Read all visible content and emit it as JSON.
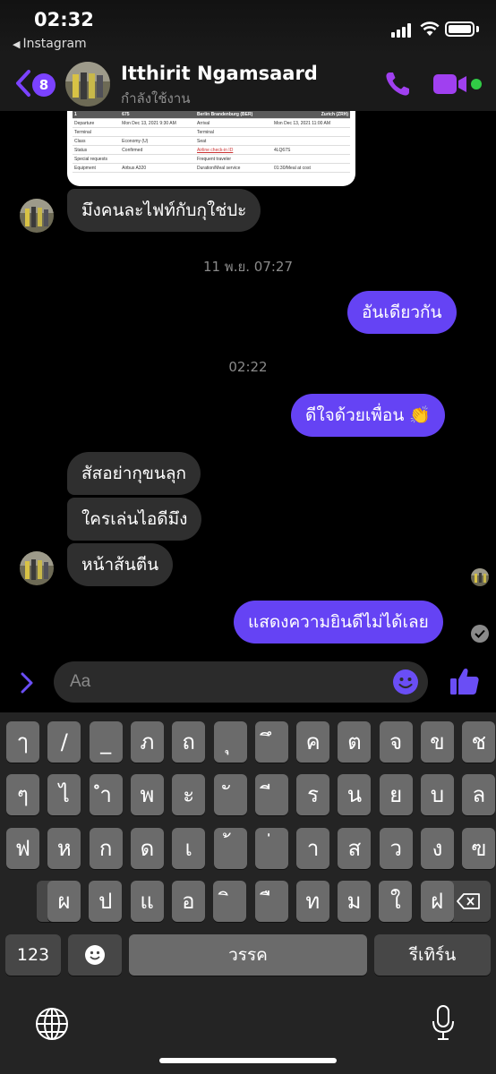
{
  "status_bar": {
    "time": "02:32",
    "back_app": "Instagram"
  },
  "header": {
    "unread_count": "8",
    "contact_name": "Itthirit Ngamsaard",
    "contact_status": "กำลังใช้งาน",
    "accent_color": "#7b42ff",
    "online_color": "#31cc46"
  },
  "attachment": {
    "header": [
      "1",
      "675",
      "Berlin Brandenburg (BER)",
      "Zurich (ZRH)"
    ],
    "rows": [
      [
        "Departure",
        "Mon Dec 13, 2021 9:30 AM",
        "Arrival",
        "Mon Dec 13, 2021 11:00 AM"
      ],
      [
        "Terminal",
        "",
        "Terminal",
        ""
      ],
      [
        "Class",
        "Economy (U)",
        "Seat",
        ""
      ],
      [
        "Status",
        "Confirmed",
        "Airline check-in ID",
        "4LQ67S"
      ],
      [
        "Special requests",
        "",
        "Frequent traveler",
        ""
      ],
      [
        "Equipment",
        "Airbus A320",
        "Duration/Meal service",
        "01:30/Meal at cost"
      ]
    ]
  },
  "messages": [
    {
      "side": "in",
      "text": "มึงคนละไฟท์กับกุใช่ปะ"
    },
    {
      "side": "time",
      "text": "11 พ.ย. 07:27"
    },
    {
      "side": "out",
      "text": "อันเดียวกัน"
    },
    {
      "side": "time",
      "text": "02:22"
    },
    {
      "side": "out",
      "text": "ดีใจด้วยเพื่อน 👏"
    },
    {
      "side": "in",
      "text": "สัสอย่ากุขนลุก"
    },
    {
      "side": "in",
      "text": "ใครเล่นไอดีมึง"
    },
    {
      "side": "in",
      "text": "หน้าส้นตีน"
    },
    {
      "side": "out",
      "text": "แสดงความยินดีไม่ได้เลย"
    }
  ],
  "composer": {
    "placeholder": "Aa"
  },
  "keyboard": {
    "row1": [
      "ๅ",
      "/",
      "_",
      "ภ",
      "ถ",
      "ุ",
      "ึ",
      "ค",
      "ต",
      "จ",
      "ข",
      "ช"
    ],
    "row2": [
      "ๆ",
      "ไ",
      "ำ",
      "พ",
      "ะ",
      "ั",
      "ี",
      "ร",
      "น",
      "ย",
      "บ",
      "ล"
    ],
    "row3": [
      "ฟ",
      "ห",
      "ก",
      "ด",
      "เ",
      "้",
      "่",
      "า",
      "ส",
      "ว",
      "ง",
      "ฃ"
    ],
    "row4": [
      "ผ",
      "ป",
      "แ",
      "อ",
      "ิ",
      "ื",
      "ท",
      "ม",
      "ใ",
      "ฝ"
    ],
    "numbers_label": "123",
    "space_label": "วรรค",
    "return_label": "รีเทิร์น"
  }
}
